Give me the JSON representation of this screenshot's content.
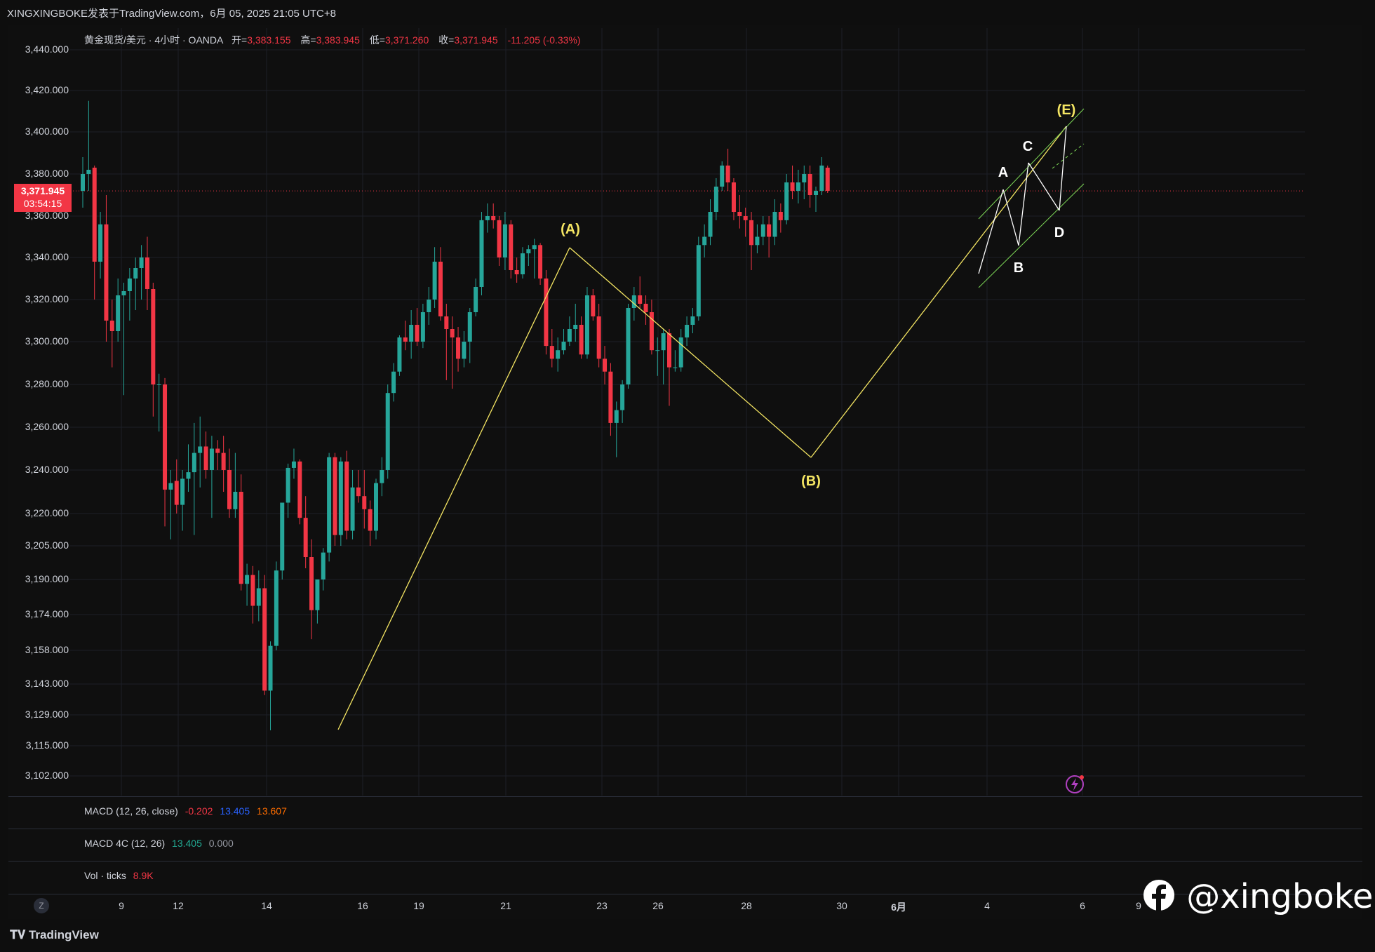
{
  "header": {
    "publisher_line": "XINGXINGBOKE发表于TradingView.com，6月 05, 2025 21:05 UTC+8"
  },
  "legend": {
    "symbol": "黄金现货/美元 · 4小时 · OANDA",
    "open_label": "开=",
    "open": "3,383.155",
    "high_label": "高=",
    "high": "3,383.945",
    "low_label": "低=",
    "low": "3,371.260",
    "close_label": "收=",
    "close": "3,371.945",
    "change": "-11.205 (-0.33%)"
  },
  "price_tag": {
    "price": "3,371.945",
    "countdown": "03:54:15"
  },
  "indicators": {
    "macd": {
      "label": "MACD (12, 26, close)",
      "v1": "-0.202",
      "v2": "13.405",
      "v3": "13.607"
    },
    "macd4c": {
      "label": "MACD 4C (12, 26)",
      "v1": "13.405",
      "v2": "0.000"
    },
    "vol": {
      "label": "Vol · ticks",
      "v1": "8.9K"
    }
  },
  "brand": {
    "tradingview": "TradingView",
    "watermark": "@xingboke"
  },
  "zoom_button": "Z",
  "colors": {
    "up": "#26a69a",
    "down": "#f23645",
    "wave_line": "#f5e663",
    "wave_label": "#f5e663",
    "sub_wave": "#ffffff",
    "channel": "#7ed957"
  },
  "chart_data": {
    "type": "candlestick",
    "title": "黄金现货/美元 · 4小时 · OANDA",
    "y_ticks": [
      "3,440.000",
      "3,420.000",
      "3,400.000",
      "3,380.000",
      "3,360.000",
      "3,340.000",
      "3,320.000",
      "3,300.000",
      "3,280.000",
      "3,260.000",
      "3,240.000",
      "3,220.000",
      "3,205.000",
      "3,190.000",
      "3,174.000",
      "3,158.000",
      "3,143.000",
      "3,129.000",
      "3,115.000",
      "3,102.000"
    ],
    "x_ticks": [
      "9",
      "12",
      "14",
      "16",
      "19",
      "21",
      "23",
      "26",
      "28",
      "30",
      "6月",
      "4",
      "6",
      "9"
    ],
    "last_price": 3371.945,
    "waves": [
      {
        "label": "(A)",
        "x": "22",
        "y": 3345
      },
      {
        "label": "(B)",
        "x": "29",
        "y": 3246
      },
      {
        "label": "(E)",
        "x": "5",
        "y": 3404
      }
    ],
    "sub_waves": [
      "A",
      "B",
      "C",
      "D"
    ],
    "candles": [
      {
        "o": 3372,
        "h": 3388,
        "l": 3364,
        "c": 3380
      },
      {
        "o": 3380,
        "h": 3415,
        "l": 3372,
        "c": 3382
      },
      {
        "o": 3383,
        "h": 3384,
        "l": 3320,
        "c": 3338
      },
      {
        "o": 3338,
        "h": 3362,
        "l": 3330,
        "c": 3356
      },
      {
        "o": 3356,
        "h": 3370,
        "l": 3300,
        "c": 3310
      },
      {
        "o": 3310,
        "h": 3320,
        "l": 3288,
        "c": 3305
      },
      {
        "o": 3305,
        "h": 3330,
        "l": 3300,
        "c": 3322
      },
      {
        "o": 3322,
        "h": 3328,
        "l": 3275,
        "c": 3324
      },
      {
        "o": 3324,
        "h": 3335,
        "l": 3310,
        "c": 3330
      },
      {
        "o": 3330,
        "h": 3340,
        "l": 3315,
        "c": 3335
      },
      {
        "o": 3335,
        "h": 3346,
        "l": 3320,
        "c": 3340
      },
      {
        "o": 3340,
        "h": 3350,
        "l": 3315,
        "c": 3325
      },
      {
        "o": 3325,
        "h": 3328,
        "l": 3265,
        "c": 3280
      },
      {
        "o": 3280,
        "h": 3285,
        "l": 3258,
        "c": 3280
      },
      {
        "o": 3280,
        "h": 3283,
        "l": 3214,
        "c": 3231
      },
      {
        "o": 3231,
        "h": 3240,
        "l": 3208,
        "c": 3234
      },
      {
        "o": 3235,
        "h": 3245,
        "l": 3220,
        "c": 3224
      },
      {
        "o": 3224,
        "h": 3240,
        "l": 3212,
        "c": 3236
      },
      {
        "o": 3236,
        "h": 3252,
        "l": 3230,
        "c": 3239
      },
      {
        "o": 3239,
        "h": 3262,
        "l": 3210,
        "c": 3248
      },
      {
        "o": 3248,
        "h": 3265,
        "l": 3232,
        "c": 3251
      },
      {
        "o": 3251,
        "h": 3258,
        "l": 3236,
        "c": 3240
      },
      {
        "o": 3240,
        "h": 3256,
        "l": 3218,
        "c": 3250
      },
      {
        "o": 3250,
        "h": 3254,
        "l": 3240,
        "c": 3248
      },
      {
        "o": 3248,
        "h": 3256,
        "l": 3230,
        "c": 3240
      },
      {
        "o": 3240,
        "h": 3250,
        "l": 3218,
        "c": 3222
      },
      {
        "o": 3222,
        "h": 3248,
        "l": 3218,
        "c": 3230
      },
      {
        "o": 3230,
        "h": 3238,
        "l": 3185,
        "c": 3188
      },
      {
        "o": 3188,
        "h": 3197,
        "l": 3178,
        "c": 3192
      },
      {
        "o": 3192,
        "h": 3196,
        "l": 3170,
        "c": 3178
      },
      {
        "o": 3178,
        "h": 3194,
        "l": 3171,
        "c": 3186
      },
      {
        "o": 3186,
        "h": 3192,
        "l": 3138,
        "c": 3140
      },
      {
        "o": 3140,
        "h": 3162,
        "l": 3122,
        "c": 3160
      },
      {
        "o": 3160,
        "h": 3198,
        "l": 3158,
        "c": 3194
      },
      {
        "o": 3194,
        "h": 3225,
        "l": 3190,
        "c": 3225
      },
      {
        "o": 3225,
        "h": 3243,
        "l": 3218,
        "c": 3241
      },
      {
        "o": 3241,
        "h": 3250,
        "l": 3236,
        "c": 3244
      },
      {
        "o": 3244,
        "h": 3245,
        "l": 3215,
        "c": 3218
      },
      {
        "o": 3218,
        "h": 3228,
        "l": 3195,
        "c": 3200
      },
      {
        "o": 3200,
        "h": 3208,
        "l": 3163,
        "c": 3176
      },
      {
        "o": 3176,
        "h": 3190,
        "l": 3170,
        "c": 3190
      },
      {
        "o": 3190,
        "h": 3204,
        "l": 3185,
        "c": 3202
      },
      {
        "o": 3202,
        "h": 3248,
        "l": 3198,
        "c": 3246
      },
      {
        "o": 3246,
        "h": 3248,
        "l": 3205,
        "c": 3210
      },
      {
        "o": 3210,
        "h": 3246,
        "l": 3205,
        "c": 3244
      },
      {
        "o": 3244,
        "h": 3249,
        "l": 3208,
        "c": 3212
      },
      {
        "o": 3212,
        "h": 3240,
        "l": 3208,
        "c": 3232
      },
      {
        "o": 3232,
        "h": 3240,
        "l": 3225,
        "c": 3228
      },
      {
        "o": 3228,
        "h": 3240,
        "l": 3213,
        "c": 3222
      },
      {
        "o": 3222,
        "h": 3226,
        "l": 3205,
        "c": 3212
      },
      {
        "o": 3212,
        "h": 3236,
        "l": 3208,
        "c": 3234
      },
      {
        "o": 3234,
        "h": 3246,
        "l": 3228,
        "c": 3240
      },
      {
        "o": 3240,
        "h": 3280,
        "l": 3236,
        "c": 3276
      },
      {
        "o": 3276,
        "h": 3290,
        "l": 3272,
        "c": 3286
      },
      {
        "o": 3286,
        "h": 3303,
        "l": 3284,
        "c": 3302
      },
      {
        "o": 3302,
        "h": 3310,
        "l": 3296,
        "c": 3300
      },
      {
        "o": 3300,
        "h": 3315,
        "l": 3292,
        "c": 3308
      },
      {
        "o": 3308,
        "h": 3316,
        "l": 3298,
        "c": 3300
      },
      {
        "o": 3300,
        "h": 3318,
        "l": 3297,
        "c": 3314
      },
      {
        "o": 3314,
        "h": 3326,
        "l": 3308,
        "c": 3320
      },
      {
        "o": 3320,
        "h": 3345,
        "l": 3316,
        "c": 3338
      },
      {
        "o": 3338,
        "h": 3345,
        "l": 3310,
        "c": 3312
      },
      {
        "o": 3312,
        "h": 3318,
        "l": 3282,
        "c": 3306
      },
      {
        "o": 3306,
        "h": 3312,
        "l": 3278,
        "c": 3302
      },
      {
        "o": 3302,
        "h": 3307,
        "l": 3286,
        "c": 3292
      },
      {
        "o": 3292,
        "h": 3305,
        "l": 3288,
        "c": 3300
      },
      {
        "o": 3300,
        "h": 3316,
        "l": 3290,
        "c": 3314
      },
      {
        "o": 3314,
        "h": 3330,
        "l": 3312,
        "c": 3326
      },
      {
        "o": 3326,
        "h": 3362,
        "l": 3322,
        "c": 3358
      },
      {
        "o": 3358,
        "h": 3366,
        "l": 3352,
        "c": 3360
      },
      {
        "o": 3360,
        "h": 3366,
        "l": 3354,
        "c": 3358
      },
      {
        "o": 3358,
        "h": 3360,
        "l": 3336,
        "c": 3340
      },
      {
        "o": 3340,
        "h": 3362,
        "l": 3334,
        "c": 3356
      },
      {
        "o": 3356,
        "h": 3358,
        "l": 3330,
        "c": 3334
      },
      {
        "o": 3334,
        "h": 3340,
        "l": 3328,
        "c": 3332
      },
      {
        "o": 3332,
        "h": 3345,
        "l": 3330,
        "c": 3342
      },
      {
        "o": 3342,
        "h": 3346,
        "l": 3336,
        "c": 3344
      },
      {
        "o": 3344,
        "h": 3349,
        "l": 3330,
        "c": 3346
      },
      {
        "o": 3346,
        "h": 3347,
        "l": 3327,
        "c": 3330
      },
      {
        "o": 3330,
        "h": 3334,
        "l": 3294,
        "c": 3298
      },
      {
        "o": 3298,
        "h": 3306,
        "l": 3288,
        "c": 3292
      },
      {
        "o": 3292,
        "h": 3302,
        "l": 3286,
        "c": 3296
      },
      {
        "o": 3296,
        "h": 3306,
        "l": 3294,
        "c": 3300
      },
      {
        "o": 3300,
        "h": 3312,
        "l": 3298,
        "c": 3306
      },
      {
        "o": 3306,
        "h": 3318,
        "l": 3300,
        "c": 3308
      },
      {
        "o": 3308,
        "h": 3312,
        "l": 3292,
        "c": 3294
      },
      {
        "o": 3294,
        "h": 3326,
        "l": 3292,
        "c": 3322
      },
      {
        "o": 3322,
        "h": 3325,
        "l": 3310,
        "c": 3312
      },
      {
        "o": 3312,
        "h": 3318,
        "l": 3288,
        "c": 3292
      },
      {
        "o": 3292,
        "h": 3298,
        "l": 3280,
        "c": 3286
      },
      {
        "o": 3286,
        "h": 3290,
        "l": 3256,
        "c": 3262
      },
      {
        "o": 3262,
        "h": 3272,
        "l": 3246,
        "c": 3268
      },
      {
        "o": 3268,
        "h": 3282,
        "l": 3262,
        "c": 3280
      },
      {
        "o": 3280,
        "h": 3318,
        "l": 3278,
        "c": 3316
      },
      {
        "o": 3316,
        "h": 3326,
        "l": 3310,
        "c": 3322
      },
      {
        "o": 3322,
        "h": 3331,
        "l": 3316,
        "c": 3318
      },
      {
        "o": 3318,
        "h": 3322,
        "l": 3308,
        "c": 3314
      },
      {
        "o": 3314,
        "h": 3320,
        "l": 3294,
        "c": 3296
      },
      {
        "o": 3296,
        "h": 3302,
        "l": 3284,
        "c": 3296
      },
      {
        "o": 3296,
        "h": 3306,
        "l": 3280,
        "c": 3304
      },
      {
        "o": 3304,
        "h": 3306,
        "l": 3270,
        "c": 3288
      },
      {
        "o": 3288,
        "h": 3296,
        "l": 3286,
        "c": 3288
      },
      {
        "o": 3288,
        "h": 3306,
        "l": 3286,
        "c": 3302
      },
      {
        "o": 3302,
        "h": 3312,
        "l": 3298,
        "c": 3308
      },
      {
        "o": 3308,
        "h": 3316,
        "l": 3304,
        "c": 3312
      },
      {
        "o": 3312,
        "h": 3350,
        "l": 3310,
        "c": 3346
      },
      {
        "o": 3346,
        "h": 3356,
        "l": 3340,
        "c": 3350
      },
      {
        "o": 3350,
        "h": 3368,
        "l": 3346,
        "c": 3362
      },
      {
        "o": 3362,
        "h": 3378,
        "l": 3358,
        "c": 3374
      },
      {
        "o": 3374,
        "h": 3386,
        "l": 3372,
        "c": 3384
      },
      {
        "o": 3384,
        "h": 3392,
        "l": 3372,
        "c": 3376
      },
      {
        "o": 3376,
        "h": 3378,
        "l": 3358,
        "c": 3362
      },
      {
        "o": 3362,
        "h": 3370,
        "l": 3354,
        "c": 3360
      },
      {
        "o": 3360,
        "h": 3364,
        "l": 3350,
        "c": 3358
      },
      {
        "o": 3358,
        "h": 3362,
        "l": 3334,
        "c": 3346
      },
      {
        "o": 3346,
        "h": 3356,
        "l": 3342,
        "c": 3350
      },
      {
        "o": 3350,
        "h": 3360,
        "l": 3346,
        "c": 3356
      },
      {
        "o": 3356,
        "h": 3360,
        "l": 3340,
        "c": 3350
      },
      {
        "o": 3350,
        "h": 3368,
        "l": 3346,
        "c": 3362
      },
      {
        "o": 3362,
        "h": 3366,
        "l": 3352,
        "c": 3358
      },
      {
        "o": 3358,
        "h": 3380,
        "l": 3356,
        "c": 3376
      },
      {
        "o": 3376,
        "h": 3384,
        "l": 3368,
        "c": 3372
      },
      {
        "o": 3372,
        "h": 3382,
        "l": 3366,
        "c": 3376
      },
      {
        "o": 3376,
        "h": 3384,
        "l": 3368,
        "c": 3380
      },
      {
        "o": 3380,
        "h": 3384,
        "l": 3364,
        "c": 3370
      },
      {
        "o": 3370,
        "h": 3374,
        "l": 3362,
        "c": 3372
      },
      {
        "o": 3372,
        "h": 3388,
        "l": 3370,
        "c": 3384
      },
      {
        "o": 3383,
        "h": 3384,
        "l": 3371,
        "c": 3372
      }
    ]
  }
}
